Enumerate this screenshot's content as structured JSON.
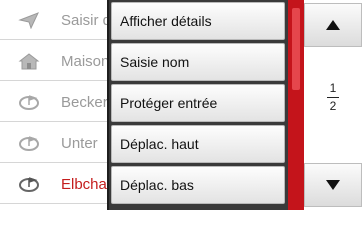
{
  "background_list": {
    "items": [
      {
        "label": "Saisir d",
        "icon": "navigation-arrow-icon"
      },
      {
        "label": "Maison",
        "icon": "home-icon"
      },
      {
        "label": "Becker",
        "icon": "destination-flag-icon"
      },
      {
        "label": "Unter",
        "icon": "destination-flag-icon"
      },
      {
        "label": "Elbcha",
        "icon": "destination-flag-icon"
      }
    ]
  },
  "menu": {
    "items": [
      {
        "label": "Afficher détails"
      },
      {
        "label": "Saisie nom"
      },
      {
        "label": "Protéger entrée"
      },
      {
        "label": "Déplac. haut"
      },
      {
        "label": "Déplac. bas"
      }
    ]
  },
  "scroll": {
    "current_page": "1",
    "total_pages": "2"
  },
  "colors": {
    "accent_red": "#c4141b",
    "highlight_text": "#c41d1d"
  }
}
